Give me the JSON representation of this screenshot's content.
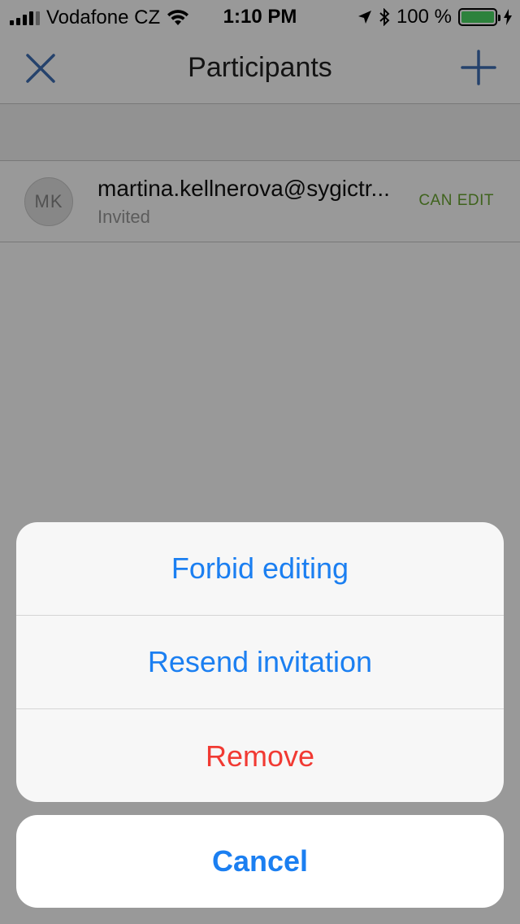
{
  "status_bar": {
    "carrier": "Vodafone CZ",
    "time": "1:10 PM",
    "battery": "100 %",
    "battery_level": 1.0
  },
  "nav": {
    "title": "Participants",
    "close_icon": "close-icon",
    "add_icon": "plus-icon"
  },
  "participants": [
    {
      "initials": "MK",
      "email": "martina.kellnerova@sygictr...",
      "status": "Invited",
      "permission": "CAN EDIT"
    }
  ],
  "action_sheet": {
    "items": [
      {
        "label": "Forbid editing",
        "style": "default"
      },
      {
        "label": "Resend invitation",
        "style": "default"
      },
      {
        "label": "Remove",
        "style": "destructive"
      }
    ],
    "cancel_label": "Cancel"
  },
  "colors": {
    "accent": "#1b7ff1",
    "destructive": "#f13a33",
    "permission": "#6aa531",
    "battery": "#4cd964"
  }
}
